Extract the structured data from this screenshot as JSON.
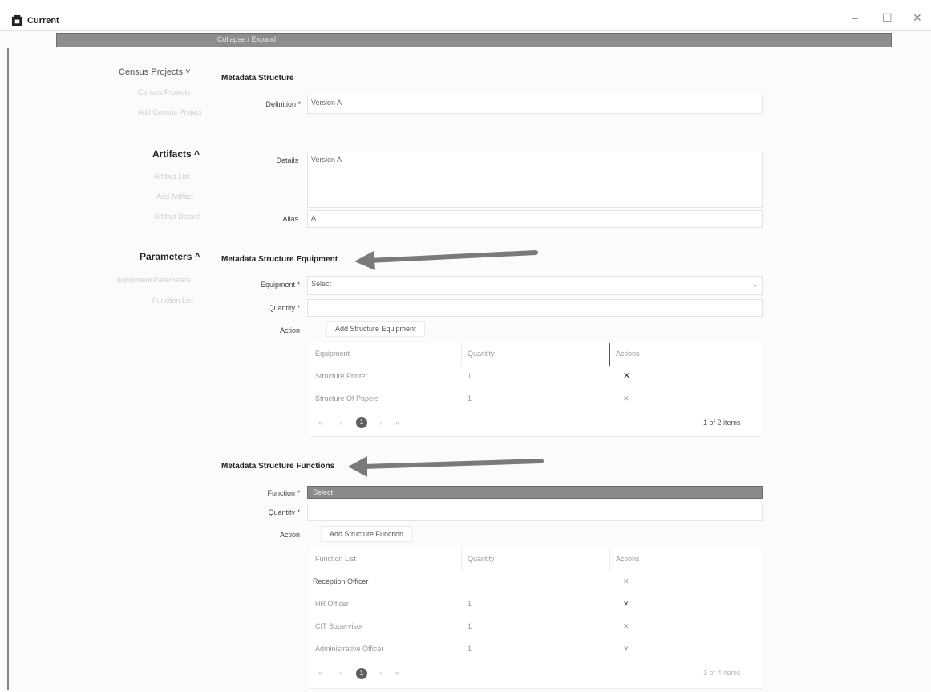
{
  "window": {
    "title": "Current",
    "minimize": "–",
    "maximize": "☐",
    "close": "✕"
  },
  "topbar": {
    "label": "Collapse / Expand"
  },
  "nav": {
    "census": {
      "label": "Census Projects ˅",
      "items": [
        "Census Projects",
        "Add Census Project"
      ]
    },
    "artifacts": {
      "label": "Artifacts ^",
      "items": [
        "Artifact List",
        "Add Artifact",
        "Artifact Details"
      ]
    },
    "parameters": {
      "label": "Parameters ^",
      "items": [
        "Equipment Parameters",
        "Function List"
      ]
    }
  },
  "metadata": {
    "heading": "Metadata Structure",
    "definition_label": "Definition *",
    "definition_value": "Version A",
    "details_label": "Details",
    "details_value": "Version A",
    "alias_label": "Alias",
    "alias_value": "A"
  },
  "equipment": {
    "heading": "Metadata Structure Equipment",
    "equipment_label": "Equipment *",
    "equipment_placeholder": "Select",
    "quantity_label": "Quantity *",
    "action_label": "Action",
    "add_label": "Add Structure Equipment",
    "columns": [
      "Equipment",
      "Quantity",
      "Actions"
    ],
    "rows": [
      {
        "name": "Structure Printer",
        "qty": "1",
        "action": "✕"
      },
      {
        "name": "Structure Of Papers",
        "qty": "1",
        "action": "✕"
      }
    ],
    "pager": {
      "first": "«",
      "prev": "‹",
      "current": "1",
      "next": "›",
      "last": "»",
      "summary": "1 of 2 items"
    }
  },
  "functions": {
    "heading": "Metadata Structure Functions",
    "function_label": "Function *",
    "function_value": "Select",
    "quantity_label": "Quantity *",
    "action_label": "Action",
    "add_label": "Add Structure Function",
    "columns": [
      "Function List",
      "Quantity",
      "Actions"
    ],
    "rows": [
      {
        "name": "Reception Officer",
        "qty": "",
        "action": "✕"
      },
      {
        "name": "HR Officer",
        "qty": "1",
        "action": "✕"
      },
      {
        "name": "CIT Supervisor",
        "qty": "1",
        "action": "✕"
      },
      {
        "name": "Administrative Officer",
        "qty": "1",
        "action": "✕"
      }
    ],
    "pager": {
      "first": "«",
      "prev": "‹",
      "current": "1",
      "next": "›",
      "last": "»",
      "summary": "1 of 4 items"
    }
  },
  "colors": {
    "arrow": "#7a7a7a",
    "topbar": "#8d8d8d",
    "accent": "#5e5e5e"
  }
}
